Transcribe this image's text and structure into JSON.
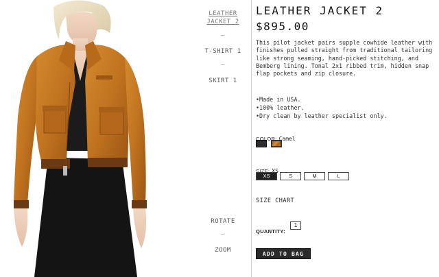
{
  "nav": {
    "items": [
      {
        "label_line1": "LEATHER",
        "label_line2": "JACKET 2"
      },
      {
        "label": "T-SHIRT 1"
      },
      {
        "label": "SKIRT 1"
      }
    ],
    "rotate": "ROTATE",
    "zoom": "ZOOM",
    "separator": "—"
  },
  "product": {
    "title": "LEATHER JACKET 2",
    "price": "$895.00",
    "description": "This pilot jacket pairs supple cowhide leather with finishes pulled straight from traditional tailoring like strong seaming, hand-picked stitching, and Bemberg lining. Tonal 2x1 ribbed trim, hidden snap flap pockets and zip closure.",
    "bullets": [
      "Made in USA.",
      "100% leather.",
      "Dry clean by leather specialist only."
    ]
  },
  "color": {
    "label": "COLOR:",
    "selected": "Camel",
    "swatches": [
      {
        "name": "Black",
        "hex": "#2e2e2e"
      },
      {
        "name": "Camel",
        "hex": "#c7771f"
      }
    ]
  },
  "size": {
    "label": "SIZE:",
    "selected": "XS",
    "options": [
      "XS",
      "S",
      "M",
      "L"
    ]
  },
  "size_chart": "SIZE CHART",
  "quantity": {
    "label": "QUANTITY:",
    "value": "1"
  },
  "add_to_bag": "ADD TO BAG"
}
